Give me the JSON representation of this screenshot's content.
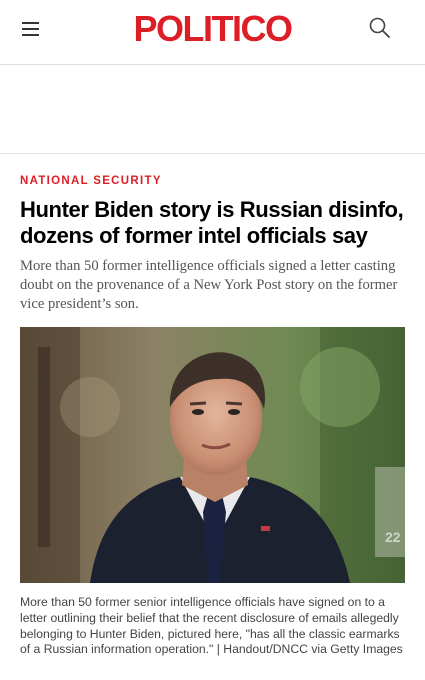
{
  "header": {
    "logo_text": "POLITICO",
    "brand_color": "#dc1f26",
    "menu_icon": "hamburger-menu-icon",
    "search_icon": "search-icon"
  },
  "article": {
    "kicker": "NATIONAL SECURITY",
    "headline": "Hunter Biden story is Russian disinfo, dozens of former intel officials say",
    "dek": "More than 50 former intelligence officials signed a letter casting doubt on the provenance of a New York Post story on the former vice president’s son.",
    "caption": "More than 50 former senior intelligence officials have signed on to a letter outlining their belief that the recent disclosure of emails allegedly belonging to Hunter Biden, pictured here, \"has all the classic earmarks of a Russian information operation.\" | Handout/DNCC via Getty Images"
  }
}
